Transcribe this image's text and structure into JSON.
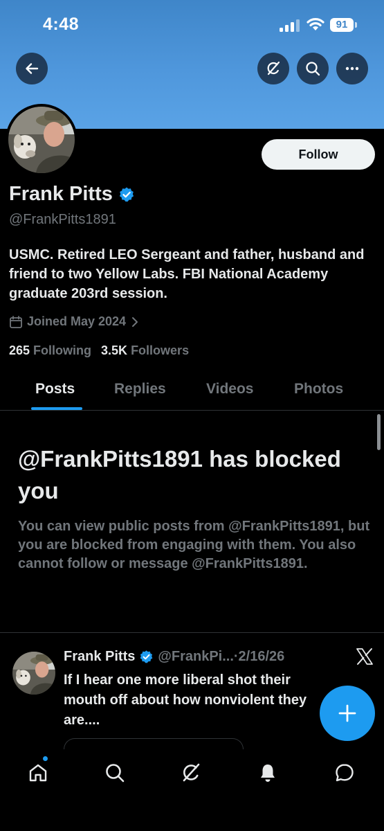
{
  "status_bar": {
    "time": "4:48",
    "battery": "91"
  },
  "profile": {
    "name": "Frank Pitts",
    "handle": "@FrankPitts1891",
    "bio": "USMC. Retired LEO Sergeant and father, husband and friend to two Yellow Labs. FBI National Academy graduate 203rd session.",
    "joined": "Joined May 2024",
    "following_count": "265",
    "following_label": "Following",
    "followers_count": "3.5K",
    "followers_label": "Followers",
    "follow_label": "Follow"
  },
  "tabs": [
    {
      "label": "Posts",
      "active": true
    },
    {
      "label": "Replies",
      "active": false
    },
    {
      "label": "Videos",
      "active": false
    },
    {
      "label": "Photos",
      "active": false
    }
  ],
  "blocked": {
    "title": "@FrankPitts1891 has blocked you",
    "message": "You can view public posts from @FrankPitts1891, but you are blocked from engaging with them. You also cannot follow or message @FrankPitts1891."
  },
  "tweet": {
    "name": "Frank Pitts",
    "handle": "@FrankPi...",
    "date": "·2/16/26",
    "text": "If I hear one more liberal shot their mouth off about how nonviolent they are...."
  },
  "icons": {
    "back": "arrow-left-icon",
    "grok": "grok-icon",
    "search": "search-icon",
    "more": "more-horizontal-icon",
    "verified": "verified-badge-icon",
    "calendar": "calendar-icon",
    "x_logo": "x-logo-icon",
    "compose": "plus-icon",
    "nav": [
      "home-icon",
      "search-icon",
      "grok-icon",
      "bell-icon",
      "message-icon"
    ]
  },
  "colors": {
    "accent": "#1d9bf0",
    "banner": "#4f97dc",
    "background": "#000000",
    "muted": "#71767b"
  }
}
